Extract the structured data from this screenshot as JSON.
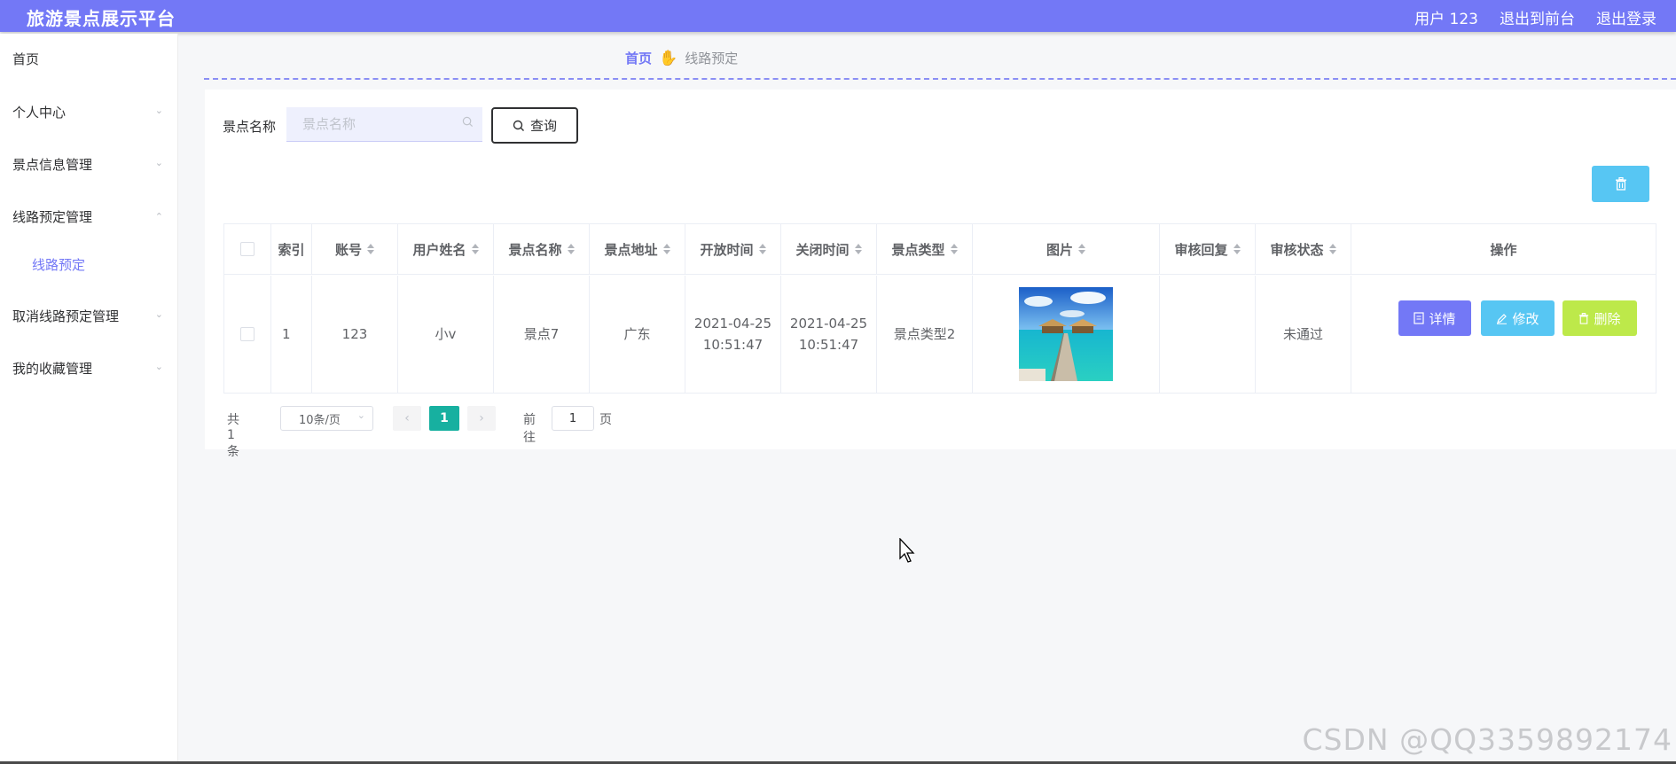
{
  "header": {
    "brand": "旅游景点展示平台",
    "user": "用户 123",
    "to_front": "退出到前台",
    "logout": "退出登录",
    "accent_color": "#7378f6"
  },
  "sidebar": {
    "items": [
      {
        "label": "首页"
      },
      {
        "label": "个人中心"
      },
      {
        "label": "景点信息管理"
      },
      {
        "label": "线路预定管理",
        "expanded": true,
        "children": [
          {
            "label": "线路预定",
            "active": true
          }
        ]
      },
      {
        "label": "取消线路预定管理"
      },
      {
        "label": "我的收藏管理"
      }
    ]
  },
  "breadcrumb": {
    "home": "首页",
    "current": "线路预定"
  },
  "search": {
    "label": "景点名称",
    "placeholder": "景点名称",
    "value": "",
    "button": "查询"
  },
  "table": {
    "columns": [
      "索引",
      "账号",
      "用户姓名",
      "景点名称",
      "景点地址",
      "开放时间",
      "关闭时间",
      "景点类型",
      "图片",
      "审核回复",
      "审核状态",
      "操作"
    ],
    "rows": [
      {
        "index": "1",
        "account": "123",
        "user_name": "小v",
        "spot_name": "景点7",
        "spot_address": "广东",
        "open_time": "2021-04-25 10:51:47",
        "close_time": "2021-04-25 10:51:47",
        "spot_type": "景点类型2",
        "image": "beach-pier-photo",
        "review_reply": "",
        "review_status": "未通过"
      }
    ],
    "actions": {
      "detail": "详情",
      "edit": "修改",
      "delete": "删除"
    }
  },
  "pagination": {
    "total": "共 1 条",
    "page_size": "10条/页",
    "current_page": "1",
    "goto_label": "前往",
    "goto_value": "1",
    "goto_unit": "页",
    "active_color": "#17b0a0"
  },
  "watermark": "CSDN @QQ3359892174"
}
